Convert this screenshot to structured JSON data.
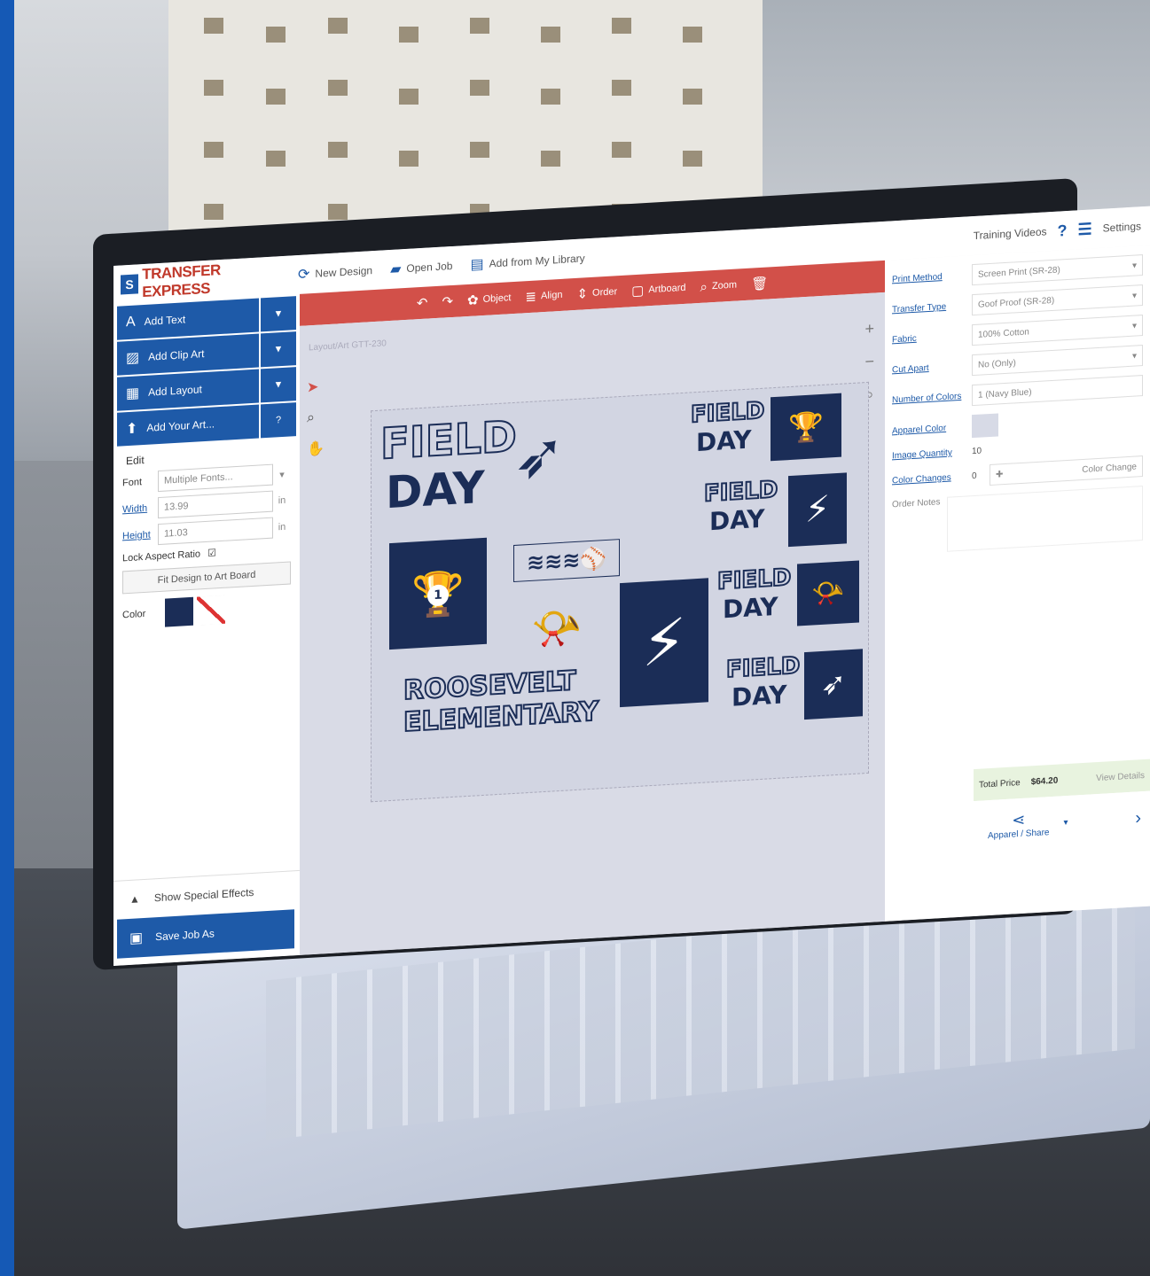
{
  "topbar": {
    "logo_badge": "S",
    "logo_text": "TRANSFER EXPRESS",
    "new_design": "New Design",
    "open_job": "Open Job",
    "add_library": "Add from My Library",
    "training": "Training Videos",
    "help": "?",
    "settings": "Settings"
  },
  "left": {
    "add_text": "Add Text",
    "add_clip_art": "Add Clip Art",
    "add_layout": "Add Layout",
    "add_your_art": "Add Your Art...",
    "edit": "Edit",
    "font_label": "Font",
    "font_value": "Multiple Fonts...",
    "width_label": "Width",
    "width_value": "13.99",
    "height_label": "Height",
    "height_value": "11.03",
    "unit": "in",
    "lock_aspect": "Lock Aspect Ratio",
    "fit_design": "Fit Design to Art Board",
    "color_label": "Color",
    "special_effects": "Show Special Effects",
    "save_job": "Save Job As"
  },
  "toolbar": {
    "object": "Object",
    "align": "Align",
    "order": "Order",
    "artboard": "Artboard",
    "zoom": "Zoom"
  },
  "canvas": {
    "artboard_label": "Layout/Art GTT-230",
    "art_text": {
      "field": "FIELD",
      "day": "DAY",
      "roosevelt": "ROOSEVELT",
      "elementary": "ELEMENTARY",
      "trophy_number": "1",
      "bolt": "⚡"
    }
  },
  "right": {
    "print_method_label": "Print Method",
    "print_method_value": "Screen Print (SR-28)",
    "transfer_type_label": "Transfer Type",
    "transfer_type_value": "Goof Proof (SR-28)",
    "fabric_label": "Fabric",
    "fabric_value": "100% Cotton",
    "cut_apart_label": "Cut Apart",
    "cut_apart_value": "No (Only)",
    "num_colors_label": "Number of Colors",
    "num_colors_value": "1 (Navy Blue)",
    "apparel_color_label": "Apparel Color",
    "image_quantity_label": "Image Quantity",
    "image_quantity_value": "10",
    "color_changes_label": "Color Changes",
    "color_changes_value": "0",
    "color_change_btn": "Color Change",
    "order_notes": "Order Notes",
    "total_label": "Total Price",
    "total_value": "$64.20",
    "view_details": "View Details",
    "apparel_share": "Apparel / Share"
  },
  "colors": {
    "primary_blue": "#1e5aa8",
    "accent_red": "#d25049",
    "art_navy": "#1b2d57"
  }
}
